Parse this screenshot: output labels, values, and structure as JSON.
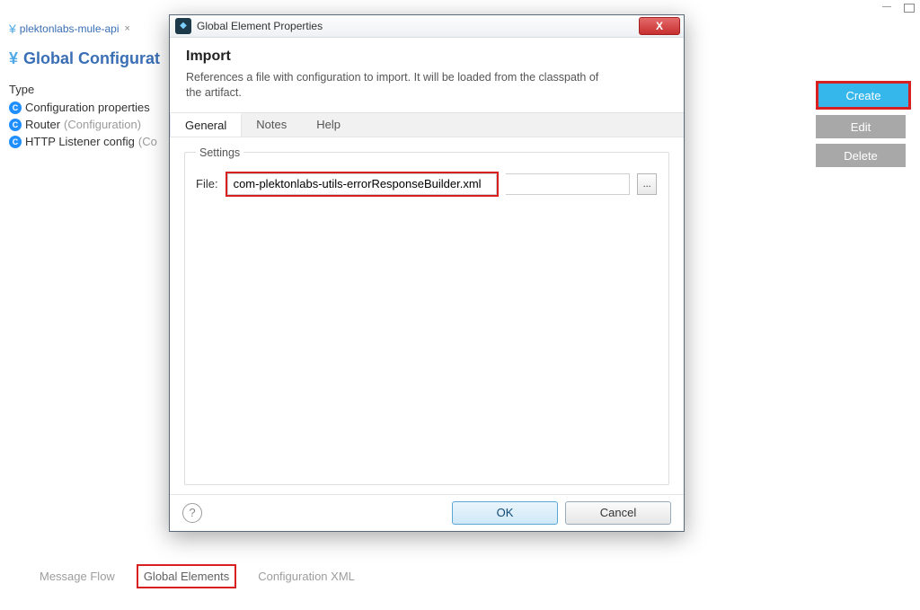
{
  "editor": {
    "file_tab": "plektonlabs-mule-api",
    "section_title": "Global Configurat",
    "type_column": "Type",
    "configs": [
      {
        "name": "Configuration properties",
        "sub": ""
      },
      {
        "name": "Router",
        "sub": "(Configuration)"
      },
      {
        "name": "HTTP Listener config",
        "sub": "(Co"
      }
    ],
    "side_buttons": {
      "create": "Create",
      "edit": "Edit",
      "delete": "Delete"
    },
    "bottom_tabs": {
      "flow": "Message Flow",
      "global": "Global Elements",
      "xml": "Configuration XML"
    }
  },
  "dialog": {
    "title": "Global Element Properties",
    "close_label": "X",
    "hero_title": "Import",
    "hero_desc": "References a file with configuration to import. It will be loaded from the classpath of the artifact.",
    "tabs": {
      "general": "General",
      "notes": "Notes",
      "help": "Help"
    },
    "settings_legend": "Settings",
    "file_label": "File:",
    "file_value": "com-plektonlabs-utils-errorResponseBuilder.xml",
    "browse_label": "...",
    "help_icon": "?",
    "ok": "OK",
    "cancel": "Cancel"
  }
}
